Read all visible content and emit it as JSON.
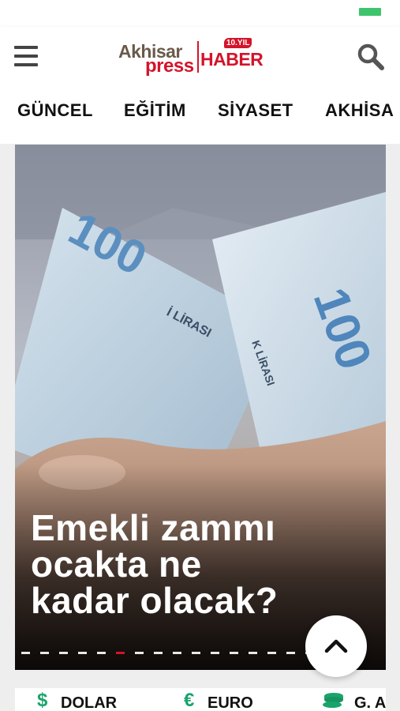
{
  "header": {
    "logo": {
      "part1": "Akhisar",
      "part2": "press",
      "part3": "HABER",
      "badge": "10.YIL"
    },
    "menu_icon": "hamburger-menu-icon",
    "search_icon": "search-icon"
  },
  "nav": {
    "tabs": [
      "GÜNCEL",
      "EĞİTİM",
      "SİYASET",
      "AKHİSA"
    ]
  },
  "hero": {
    "title_lines": [
      "Emekli zammı",
      "ocakta ne",
      "kadar olacak?"
    ],
    "slide_count": 18,
    "active_slide": 5
  },
  "scroll_top_icon": "chevron-up-icon",
  "ticker": {
    "items": [
      {
        "icon": "dollar-icon",
        "symbol": "$",
        "label": "DOLAR"
      },
      {
        "icon": "euro-icon",
        "symbol": "€",
        "label": "EURO"
      },
      {
        "icon": "gold-coins-icon",
        "symbol": "",
        "label": "G. A"
      }
    ]
  },
  "colors": {
    "brand_red": "#d3142b",
    "ticker_green": "#1aa46c",
    "status_green": "#3ec46d"
  }
}
